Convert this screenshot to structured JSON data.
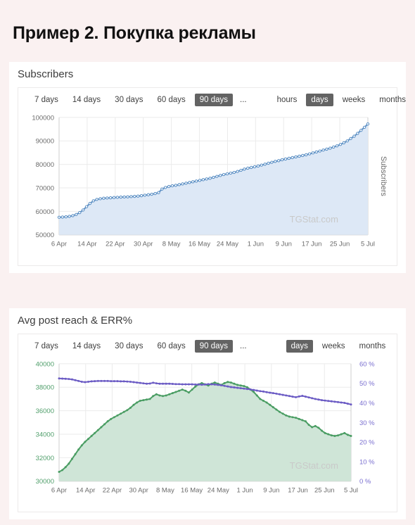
{
  "page": {
    "title": "Пример 2. Покупка рекламы",
    "background_color": "#faf1f1"
  },
  "panels": [
    {
      "id": "subscribers",
      "title": "Subscribers",
      "toolbar": {
        "range_buttons": [
          "7 days",
          "14 days",
          "30 days",
          "60 days",
          "90 days"
        ],
        "active_range": "90 days",
        "ellipsis": "...",
        "granularity_buttons": [
          "hours",
          "days",
          "weeks",
          "months"
        ],
        "active_granularity": "days"
      },
      "watermark": "TGStat.com",
      "side_label": "Subscribers"
    },
    {
      "id": "reach",
      "title": "Avg post reach & ERR%",
      "toolbar": {
        "range_buttons": [
          "7 days",
          "14 days",
          "30 days",
          "60 days",
          "90 days"
        ],
        "active_range": "90 days",
        "ellipsis": "...",
        "granularity_buttons": [
          "days",
          "weeks",
          "months"
        ],
        "active_granularity": "days"
      },
      "watermark": "TGStat.com",
      "side_label": ""
    }
  ],
  "chart_data": [
    {
      "type": "area",
      "title": "Subscribers",
      "xlabel": "",
      "ylabel": "Subscribers",
      "grid": true,
      "legend": "none",
      "line_color": "#5b8fc4",
      "fill_color": "#dde8f6",
      "ylim": [
        50000,
        100000
      ],
      "yticks": [
        50000,
        60000,
        70000,
        80000,
        90000,
        100000
      ],
      "xticks": [
        "6 Apr",
        "14 Apr",
        "22 Apr",
        "30 Apr",
        "8 May",
        "16 May",
        "24 May",
        "1 Jun",
        "9 Jun",
        "17 Jun",
        "25 Jun",
        "5 Jul"
      ],
      "x": [
        0,
        1,
        2,
        3,
        4,
        5,
        6,
        7,
        8,
        9,
        10,
        11,
        12,
        13,
        14,
        15,
        16,
        17,
        18,
        19,
        20,
        21,
        22,
        23,
        24,
        25,
        26,
        27,
        28,
        29,
        30,
        31,
        32,
        33,
        34,
        35,
        36,
        37,
        38,
        39,
        40,
        41,
        42,
        43,
        44,
        45,
        46,
        47,
        48,
        49,
        50,
        51,
        52,
        53,
        54,
        55,
        56,
        57,
        58,
        59,
        60,
        61,
        62,
        63,
        64,
        65,
        66,
        67,
        68,
        69,
        70,
        71,
        72,
        73,
        74,
        75,
        76,
        77,
        78,
        79,
        80,
        81,
        82,
        83,
        84,
        85,
        86,
        87,
        88,
        89,
        90
      ],
      "values": [
        57500,
        57600,
        57700,
        57900,
        58200,
        58700,
        59500,
        60600,
        62000,
        63400,
        64500,
        65100,
        65400,
        65600,
        65700,
        65800,
        65900,
        66000,
        66100,
        66150,
        66200,
        66300,
        66400,
        66500,
        66700,
        66900,
        67100,
        67300,
        67600,
        68000,
        69500,
        70200,
        70600,
        70900,
        71100,
        71400,
        71700,
        72000,
        72300,
        72600,
        72900,
        73200,
        73500,
        73800,
        74100,
        74500,
        74900,
        75300,
        75700,
        76000,
        76300,
        76600,
        77000,
        77500,
        78000,
        78400,
        78700,
        79000,
        79300,
        79700,
        80100,
        80500,
        80900,
        81300,
        81600,
        82000,
        82300,
        82600,
        82900,
        83200,
        83500,
        83800,
        84100,
        84500,
        84900,
        85300,
        85700,
        86100,
        86500,
        86900,
        87400,
        87900,
        88500,
        89200,
        90000,
        91000,
        92000,
        93200,
        94500,
        95800,
        97200
      ]
    },
    {
      "type": "line",
      "title": "Avg post reach & ERR%",
      "xlabel": "",
      "grid": true,
      "legend": "none",
      "series": [
        {
          "name": "Avg post reach",
          "axis": "left",
          "line_color": "#4a9d63",
          "fill_color": "#cfe5d7",
          "ylim": [
            30000,
            40000
          ],
          "yticks": [
            30000,
            32000,
            34000,
            36000,
            38000,
            40000
          ],
          "values": [
            30800,
            30950,
            31200,
            31500,
            31900,
            32300,
            32700,
            33050,
            33350,
            33600,
            33850,
            34100,
            34350,
            34600,
            34850,
            35100,
            35300,
            35450,
            35600,
            35750,
            35900,
            36050,
            36250,
            36500,
            36700,
            36850,
            36900,
            36950,
            37000,
            37250,
            37400,
            37300,
            37250,
            37300,
            37400,
            37500,
            37600,
            37700,
            37800,
            37700,
            37550,
            37800,
            38050,
            38250,
            38350,
            38250,
            38150,
            38300,
            38400,
            38300,
            38200,
            38350,
            38450,
            38400,
            38300,
            38200,
            38150,
            38100,
            38000,
            37800,
            37600,
            37300,
            37000,
            36850,
            36700,
            36500,
            36300,
            36100,
            35900,
            35750,
            35600,
            35500,
            35450,
            35400,
            35300,
            35200,
            35100,
            34800,
            34600,
            34700,
            34550,
            34300,
            34100,
            34000,
            33900,
            33850,
            33900,
            34000,
            34100,
            33950,
            33850
          ]
        },
        {
          "name": "ERR%",
          "axis": "right",
          "line_color": "#6b5bc4",
          "ylim": [
            0,
            60
          ],
          "yticks": [
            0,
            10,
            20,
            30,
            40,
            50,
            60
          ],
          "values": [
            52.5,
            52.4,
            52.3,
            52.2,
            52.0,
            51.6,
            51.2,
            50.8,
            50.6,
            50.8,
            51.0,
            51.1,
            51.2,
            51.2,
            51.2,
            51.2,
            51.1,
            51.1,
            51.1,
            51.0,
            51.0,
            50.9,
            50.8,
            50.6,
            50.4,
            50.2,
            50.0,
            49.8,
            49.9,
            50.3,
            50.0,
            49.8,
            49.8,
            49.8,
            49.8,
            49.7,
            49.6,
            49.6,
            49.5,
            49.5,
            49.5,
            49.5,
            49.4,
            49.4,
            49.3,
            49.4,
            49.6,
            49.5,
            49.4,
            49.2,
            49.0,
            48.7,
            48.4,
            48.1,
            47.9,
            47.7,
            47.5,
            47.3,
            47.1,
            46.9,
            46.6,
            46.3,
            46.0,
            45.8,
            45.5,
            45.2,
            45.0,
            44.7,
            44.4,
            44.1,
            43.8,
            43.5,
            43.2,
            42.9,
            43.3,
            43.6,
            43.2,
            42.8,
            42.4,
            42.0,
            41.7,
            41.4,
            41.2,
            41.0,
            40.8,
            40.6,
            40.4,
            40.2,
            40.0,
            39.6,
            39.2
          ]
        }
      ],
      "xticks": [
        "6 Apr",
        "14 Apr",
        "22 Apr",
        "30 Apr",
        "8 May",
        "16 May",
        "24 May",
        "1 Jun",
        "9 Jun",
        "17 Jun",
        "25 Jun",
        "5 Jul"
      ],
      "right_axis_suffix": " %"
    }
  ]
}
